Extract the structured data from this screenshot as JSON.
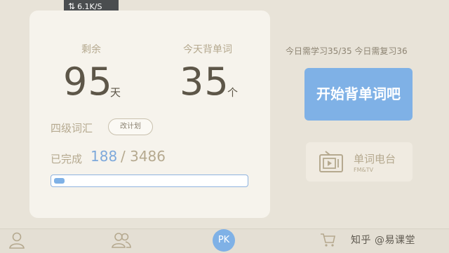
{
  "status_bar": {
    "network_speed": "6.1K/S"
  },
  "stats": {
    "remaining": {
      "label": "剩余",
      "value": "95",
      "unit": "天"
    },
    "today_words": {
      "label": "今天背单词",
      "value": "35",
      "unit": "个"
    }
  },
  "plan": {
    "level": "四级词汇",
    "change_plan_label": "改计划",
    "completed_label": "已完成",
    "completed_count": "188",
    "separator": "/",
    "total_count": "3486",
    "progress_fraction": 0.054
  },
  "today_task": "今日需学习35/35 今日需复习36",
  "start_button_label": "开始背单词吧",
  "radio": {
    "title": "单词电台",
    "subtitle": "FM&TV"
  },
  "tabbar": {
    "pk_label": "PK"
  },
  "watermark": "知乎 @易课堂",
  "colors": {
    "accent": "#7fb1e6",
    "card": "#f6f3ec",
    "background": "#e8e3d8"
  }
}
